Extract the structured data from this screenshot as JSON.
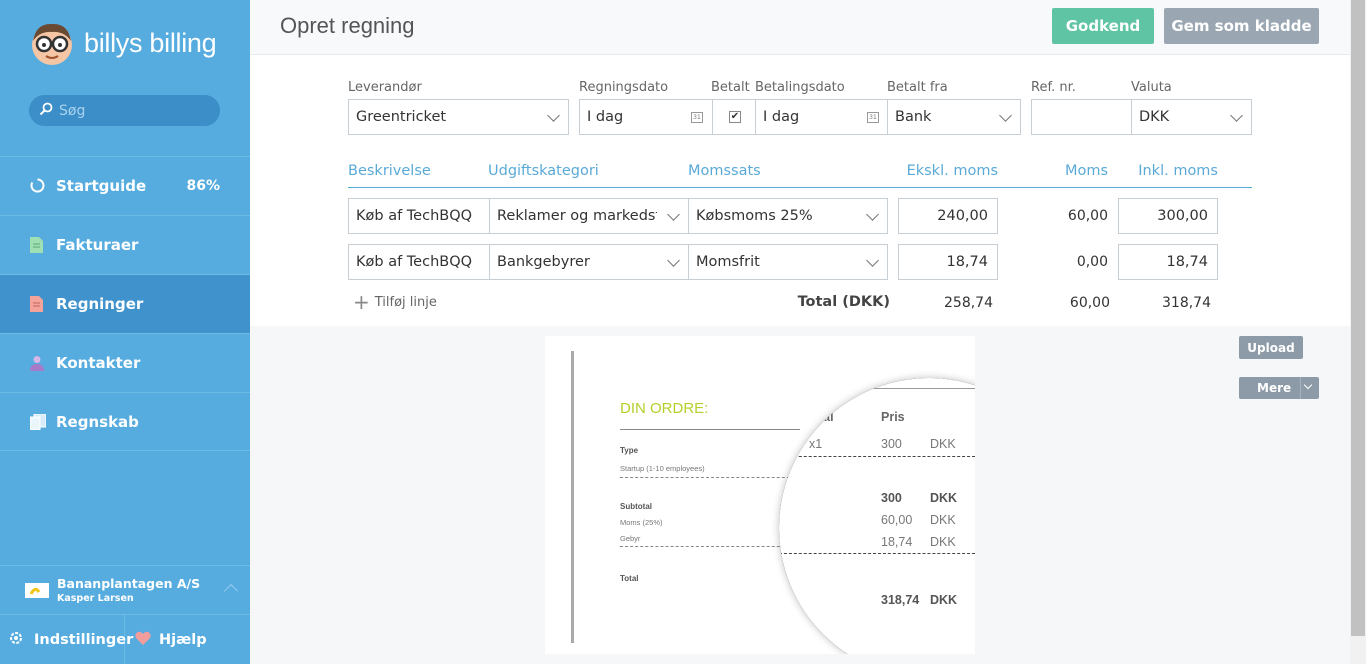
{
  "sidebar": {
    "brand": "billys billing",
    "search_placeholder": "Søg",
    "items": [
      {
        "label": "Startguide",
        "badge": "86%"
      },
      {
        "label": "Fakturaer"
      },
      {
        "label": "Regninger"
      },
      {
        "label": "Kontakter"
      },
      {
        "label": "Regnskab"
      }
    ],
    "org": {
      "name": "Bananplantagen A/S",
      "user": "Kasper Larsen"
    },
    "settings_label": "Indstillinger",
    "help_label": "Hjælp"
  },
  "header": {
    "title": "Opret regning",
    "approve_label": "Godkend",
    "draft_label": "Gem som kladde"
  },
  "form": {
    "supplier_label": "Leverandør",
    "supplier_value": "Greentricket",
    "bill_date_label": "Regningsdato",
    "bill_date_value": "I dag",
    "paid_label": "Betalt",
    "payment_date_label": "Betalingsdato",
    "payment_date_value": "I dag",
    "paid_from_label": "Betalt fra",
    "paid_from_value": "Bank",
    "ref_label": "Ref. nr.",
    "ref_value": "",
    "currency_label": "Valuta",
    "currency_value": "DKK"
  },
  "lines": {
    "headers": {
      "description": "Beskrivelse",
      "category": "Udgiftskategori",
      "vat_rate": "Momssats",
      "excl": "Ekskl. moms",
      "vat": "Moms",
      "incl": "Inkl. moms"
    },
    "rows": [
      {
        "description": "Køb af TechBQQ",
        "category": "Reklamer og markedsføring",
        "vat_rate": "Købsmoms 25%",
        "excl": "240,00",
        "vat": "60,00",
        "incl": "300,00"
      },
      {
        "description": "Køb af TechBQQ",
        "category": "Bankgebyrer",
        "vat_rate": "Momsfrit",
        "excl": "18,74",
        "vat": "0,00",
        "incl": "18,74"
      }
    ],
    "add_label": "Tilføj linje",
    "total_label": "Total (DKK)",
    "total_excl": "258,74",
    "total_vat": "60,00",
    "total_incl": "318,74"
  },
  "attachment": {
    "upload_label": "Upload",
    "more_label": "Mere",
    "doc": {
      "heading": "DIN ORDRE:",
      "type_label": "Type",
      "type_value": "Startup (1-10 employees)",
      "subtotal_label": "Subtotal",
      "vat_label": "Moms (25%)",
      "fee_label": "Gebyr",
      "total_label": "Total",
      "col_partial": "tal",
      "col_price": "Pris",
      "qty": "x1",
      "price": "300",
      "currency": "DKK",
      "subtotal_value": "300",
      "vat_value": "60,00",
      "fee_value": "18,74",
      "total_value": "318,74"
    }
  },
  "colors": {
    "sidebar": "#57acdf",
    "sidebar_active": "#3f92cc",
    "approve": "#5fc4a3",
    "draft": "#9aa7b2",
    "accent": "#5aaad8",
    "doc_heading": "#b7cf2a"
  }
}
